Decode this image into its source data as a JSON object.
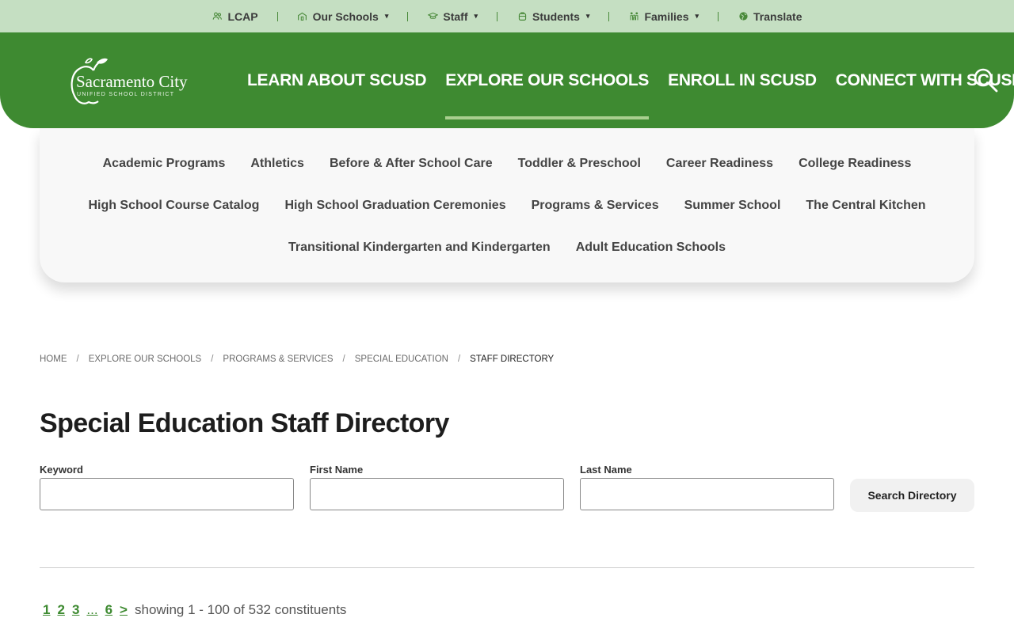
{
  "utility_bar": {
    "items": [
      {
        "label": "LCAP",
        "icon": "people-icon",
        "has_dropdown": false
      },
      {
        "label": "Our Schools",
        "icon": "school-icon",
        "has_dropdown": true
      },
      {
        "label": "Staff",
        "icon": "graduation-cap-icon",
        "has_dropdown": true
      },
      {
        "label": "Students",
        "icon": "backpack-icon",
        "has_dropdown": true
      },
      {
        "label": "Families",
        "icon": "family-icon",
        "has_dropdown": true
      },
      {
        "label": "Translate",
        "icon": "globe-icon",
        "has_dropdown": false
      }
    ],
    "caret": "▾"
  },
  "header": {
    "logo_title": "Sacramento City",
    "logo_subtitle": "UNIFIED SCHOOL DISTRICT",
    "nav": [
      {
        "label": "LEARN ABOUT SCUSD",
        "active": false
      },
      {
        "label": "EXPLORE OUR SCHOOLS",
        "active": true
      },
      {
        "label": "ENROLL IN SCUSD",
        "active": false
      },
      {
        "label": "CONNECT WITH SCUSD",
        "active": false
      }
    ]
  },
  "dropdown": {
    "row1": [
      "Academic Programs",
      "Athletics",
      "Before & After School Care",
      "Toddler & Preschool",
      "Career Readiness",
      "College Readiness"
    ],
    "row2": [
      "High School Course Catalog",
      "High School Graduation Ceremonies",
      "Programs & Services",
      "Summer School",
      "The Central Kitchen"
    ],
    "row3": [
      "Transitional Kindergarten and Kindergarten",
      "Adult Education Schools"
    ]
  },
  "breadcrumb": {
    "items": [
      "HOME",
      "EXPLORE OUR SCHOOLS",
      "PROGRAMS & SERVICES",
      "SPECIAL EDUCATION"
    ],
    "current": "STAFF DIRECTORY",
    "separator": "/"
  },
  "page": {
    "title": "Special Education Staff Directory"
  },
  "form": {
    "keyword_label": "Keyword",
    "keyword_value": "",
    "first_name_label": "First Name",
    "first_name_value": "",
    "last_name_label": "Last Name",
    "last_name_value": "",
    "submit_label": "Search Directory"
  },
  "pagination": {
    "pages": [
      "1",
      "2",
      "3"
    ],
    "ellipsis": "...",
    "last_page": "6",
    "next": ">",
    "status": "showing 1 - 100 of 532 constituents"
  },
  "colors": {
    "brand_green": "#3e8a31",
    "utility_bar": "#c5dfc2",
    "active_underline": "#a9cf8f"
  }
}
